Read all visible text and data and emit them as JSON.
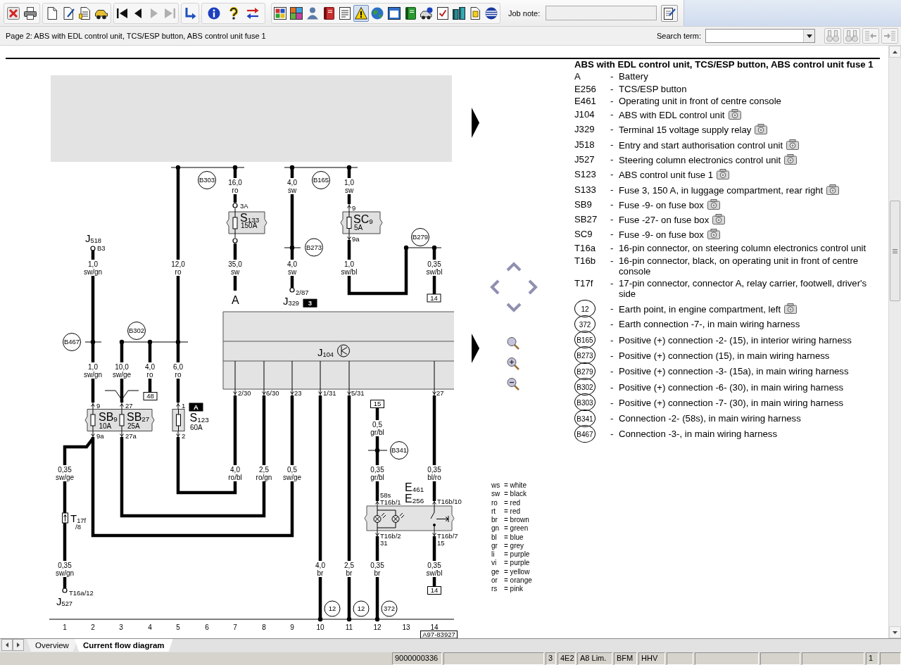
{
  "toolbar": {
    "page_nav": [
      {
        "disabled": false
      },
      {
        "disabled": false
      },
      {
        "disabled": true
      },
      {
        "disabled": true
      }
    ],
    "view_tools": [
      {
        "selected": false
      },
      {
        "selected": false
      },
      {
        "selected": false
      },
      {
        "selected": false
      },
      {
        "selected": false
      },
      {
        "selected": true
      },
      {
        "selected": false
      },
      {
        "selected": false
      },
      {
        "selected": false
      },
      {
        "selected": false
      },
      {
        "selected": false
      },
      {
        "selected": false
      },
      {
        "selected": false
      },
      {
        "selected": false
      }
    ],
    "job_note": {
      "label": "Job note:",
      "disabled": true
    }
  },
  "info_bar": {
    "page_title": "Page 2: ABS with EDL control unit, TCS/ESP button, ABS control unit fuse 1",
    "search": {
      "label": "Search term:"
    },
    "search_tools": [
      {
        "disabled": true
      },
      {
        "disabled": true
      },
      {
        "disabled": true
      },
      {
        "disabled": true
      }
    ]
  },
  "diagram": {
    "component_labels": [
      "J$_{518}$",
      "S$_{133}$",
      "SC$_{9}$",
      "A",
      "J$_{329}$",
      "SB$_{9}$",
      "SB$_{27}$",
      "S$_{123}$",
      "J$_{104}$",
      "T$_{17f}$",
      "E$_{461}$",
      "E$_{256}$",
      "J$_{527}$"
    ],
    "fuse_ratings": [
      "150A",
      "5A",
      "10A",
      "25A",
      "60A"
    ],
    "wires": [
      {
        "gauge": "16,0",
        "insulation": "ro"
      },
      {
        "gauge": "4,0",
        "insulation": "sw"
      },
      {
        "gauge": "1,0",
        "insulation": "sw"
      },
      {
        "gauge": "1,0",
        "insulation": "sw/gn"
      },
      {
        "gauge": "12,0",
        "insulation": "ro"
      },
      {
        "gauge": "35,0",
        "insulation": "sw"
      },
      {
        "gauge": "4,0",
        "insulation": "sw"
      },
      {
        "gauge": "1,0",
        "insulation": "sw/bl"
      },
      {
        "gauge": "0,35",
        "insulation": "sw/bl"
      },
      {
        "gauge": "1,0",
        "insulation": "sw/gn"
      },
      {
        "gauge": "10,0",
        "insulation": "sw/ge"
      },
      {
        "gauge": "4,0",
        "insulation": "ro"
      },
      {
        "gauge": "6,0",
        "insulation": "ro"
      },
      {
        "gauge": "0,5",
        "insulation": "gr/bl"
      },
      {
        "gauge": "0,35",
        "insulation": "sw/ge"
      },
      {
        "gauge": "4,0",
        "insulation": "ro/bl"
      },
      {
        "gauge": "2,5",
        "insulation": "ro/gn"
      },
      {
        "gauge": "0,5",
        "insulation": "sw/ge"
      },
      {
        "gauge": "0,35",
        "insulation": "gr/bl"
      },
      {
        "gauge": "0,35",
        "insulation": "bl/ro"
      },
      {
        "gauge": "0,35",
        "insulation": "sw/gn"
      },
      {
        "gauge": "4,0",
        "insulation": "br"
      },
      {
        "gauge": "2,5",
        "insulation": "br"
      },
      {
        "gauge": "0,35",
        "insulation": "br"
      },
      {
        "gauge": "0,35",
        "insulation": "sw/bl"
      }
    ],
    "pins": [
      "3A",
      "9",
      "9a",
      "B3",
      "2/87",
      "9",
      "27",
      "1",
      "9a",
      "27a",
      "2",
      "2/30",
      "6/30",
      "23",
      "1/31",
      "5/31",
      "27",
      "/8",
      "T16a/12",
      "58s",
      "T16b/1",
      "T16b/10",
      "T16b/2",
      "31",
      "T16b/7",
      "15"
    ],
    "junctions": [
      "B303",
      "B165",
      "B273",
      "B279",
      "B467",
      "B302",
      "B341"
    ],
    "earth_points": [
      "12",
      "12",
      "372"
    ],
    "references": [
      {
        "kind": "box",
        "text": "14"
      },
      {
        "kind": "box",
        "text": "48"
      },
      {
        "kind": "box",
        "text": "15"
      },
      {
        "kind": "box",
        "text": "14"
      },
      {
        "kind": "tag",
        "text": "3"
      },
      {
        "kind": "tag",
        "text": "A"
      }
    ],
    "columns": [
      "1",
      "2",
      "3",
      "4",
      "5",
      "6",
      "7",
      "8",
      "9",
      "10",
      "11",
      "12",
      "13",
      "14"
    ],
    "drawing_number": "A97-83927"
  },
  "color_key": [
    {
      "code": "ws",
      "text": "= white"
    },
    {
      "code": "sw",
      "text": "= black"
    },
    {
      "code": "ro",
      "text": "= red"
    },
    {
      "code": "rt",
      "text": "= red"
    },
    {
      "code": "br",
      "text": "= brown"
    },
    {
      "code": "gn",
      "text": "= green"
    },
    {
      "code": "bl",
      "text": "= blue"
    },
    {
      "code": "gr",
      "text": "= grey"
    },
    {
      "code": "li",
      "text": "= purple"
    },
    {
      "code": "vi",
      "text": "= purple"
    },
    {
      "code": "ge",
      "text": "= yellow"
    },
    {
      "code": "or",
      "text": "= orange"
    },
    {
      "code": "rs",
      "text": "= pink"
    }
  ],
  "legend": {
    "title": "ABS with EDL control unit, TCS/ESP button, ABS control unit fuse 1",
    "items": [
      {
        "kind": "code",
        "code": "A",
        "dash": "-",
        "text": "Battery",
        "photo": false
      },
      {
        "kind": "code",
        "code": "E256",
        "dash": "-",
        "text": "TCS/ESP button",
        "photo": false
      },
      {
        "kind": "code",
        "code": "E461",
        "dash": "-",
        "text": "Operating unit in front of centre console",
        "photo": false
      },
      {
        "kind": "code",
        "code": "J104",
        "dash": "-",
        "text": "ABS with EDL control unit",
        "photo": true
      },
      {
        "kind": "code",
        "code": "J329",
        "dash": "-",
        "text": "Terminal 15 voltage supply relay",
        "photo": true
      },
      {
        "kind": "code",
        "code": "J518",
        "dash": "-",
        "text": "Entry and start authorisation control unit",
        "photo": true
      },
      {
        "kind": "code",
        "code": "J527",
        "dash": "-",
        "text": "Steering column electronics control unit",
        "photo": true
      },
      {
        "kind": "code",
        "code": "S123",
        "dash": "-",
        "text": "ABS control unit fuse 1",
        "photo": true
      },
      {
        "kind": "code",
        "code": "S133",
        "dash": "-",
        "text": "Fuse 3, 150 A, in luggage compartment, rear right",
        "photo": true
      },
      {
        "kind": "code",
        "code": "SB9",
        "dash": "-",
        "text": "Fuse -9- on fuse box",
        "photo": true
      },
      {
        "kind": "code",
        "code": "SB27",
        "dash": "-",
        "text": "Fuse -27- on fuse box",
        "photo": true
      },
      {
        "kind": "code",
        "code": "SC9",
        "dash": "-",
        "text": "Fuse -9- on fuse box",
        "photo": true
      },
      {
        "kind": "code",
        "code": "T16a",
        "dash": "-",
        "text": "16-pin connector, on steering column electronics control unit",
        "photo": false
      },
      {
        "kind": "code",
        "code": "T16b",
        "dash": "-",
        "text": "16-pin connector, black, on operating unit in front of centre console",
        "photo": false
      },
      {
        "kind": "code",
        "code": "T17f",
        "dash": "-",
        "text": "17-pin connector, connector A, relay carrier, footwell, driver's side",
        "photo": false
      },
      {
        "kind": "circle",
        "code": "12",
        "dash": "-",
        "text": "Earth point, in engine compartment, left",
        "photo": true
      },
      {
        "kind": "circle",
        "code": "372",
        "dash": "-",
        "text": "Earth connection -7-, in main wiring harness",
        "photo": false
      },
      {
        "kind": "circle",
        "code": "B165",
        "dash": "-",
        "text": "Positive (+) connection -2- (15), in interior wiring harness",
        "photo": false
      },
      {
        "kind": "circle",
        "code": "B273",
        "dash": "-",
        "text": "Positive (+) connection (15), in main wiring harness",
        "photo": false
      },
      {
        "kind": "circle",
        "code": "B279",
        "dash": "-",
        "text": "Positive (+) connection -3- (15a), in main wiring harness",
        "photo": false
      },
      {
        "kind": "circle",
        "code": "B302",
        "dash": "-",
        "text": "Positive (+) connection -6- (30), in main wiring harness",
        "photo": false
      },
      {
        "kind": "circle",
        "code": "B303",
        "dash": "-",
        "text": "Positive (+) connection -7- (30), in main wiring harness",
        "photo": false
      },
      {
        "kind": "circle",
        "code": "B341",
        "dash": "-",
        "text": "Connection -2- (58s), in main wiring harness",
        "photo": false
      },
      {
        "kind": "circle",
        "code": "B467",
        "dash": "-",
        "text": "Connection -3-, in main wiring harness",
        "photo": false
      }
    ]
  },
  "tabs": [
    {
      "label": "Overview",
      "selected": false
    },
    {
      "label": "Current flow diagram",
      "selected": true
    }
  ],
  "status_bar": [
    "9000000336",
    "3",
    "4E2",
    "A8 Lim.",
    "BFM",
    "HHV",
    "1"
  ]
}
